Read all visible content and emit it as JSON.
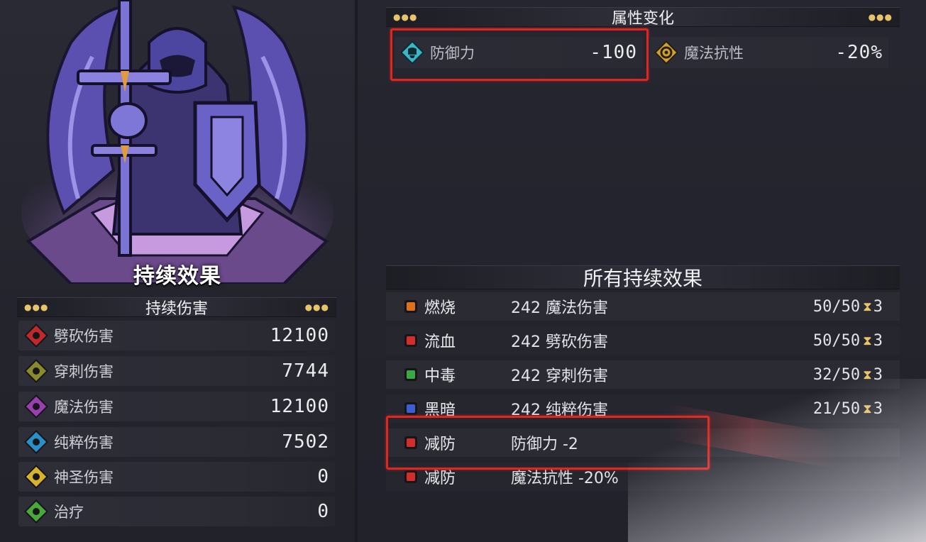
{
  "left": {
    "title": "持续效果",
    "section": "持续伤害",
    "stats": [
      {
        "icon": "slash-damage-icon",
        "label": "劈砍伤害",
        "value": "12100",
        "color": "#c0282a"
      },
      {
        "icon": "pierce-damage-icon",
        "label": "穿刺伤害",
        "value": "7744",
        "color": "#8a8a2a"
      },
      {
        "icon": "magic-damage-icon",
        "label": "魔法伤害",
        "value": "12100",
        "color": "#9a3fb0"
      },
      {
        "icon": "pure-damage-icon",
        "label": "纯粹伤害",
        "value": "7502",
        "color": "#2a8fc9"
      },
      {
        "icon": "holy-damage-icon",
        "label": "神圣伤害",
        "value": "0",
        "color": "#d8b22a"
      },
      {
        "icon": "heal-icon",
        "label": "治疗",
        "value": "0",
        "color": "#4aa83a"
      }
    ]
  },
  "right": {
    "attr_title": "属性变化",
    "attributes": [
      {
        "icon": "defense-icon",
        "label": "防御力",
        "value": "-100",
        "color": "#38b7c8"
      },
      {
        "icon": "magic-resist-icon",
        "label": "魔法抗性",
        "value": "-20%",
        "color": "#caa238"
      }
    ],
    "effects_title": "所有持续效果",
    "effects": [
      {
        "icon": "burn-icon",
        "name": "燃烧",
        "desc": "242 魔法伤害",
        "count": "50/50",
        "turns": "3",
        "color": "#e0701a"
      },
      {
        "icon": "bleed-icon",
        "name": "流血",
        "desc": "242 劈砍伤害",
        "count": "50/50",
        "turns": "3",
        "color": "#d0302a"
      },
      {
        "icon": "poison-icon",
        "name": "中毒",
        "desc": "242 穿刺伤害",
        "count": "32/50",
        "turns": "3",
        "color": "#3aa844"
      },
      {
        "icon": "dark-icon",
        "name": "黑暗",
        "desc": "242 纯粹伤害",
        "count": "21/50",
        "turns": "3",
        "color": "#3b5fd0"
      },
      {
        "icon": "armor-break-icon",
        "name": "减防",
        "desc": "防御力 -2",
        "count": "",
        "turns": "",
        "color": "#d0302a"
      },
      {
        "icon": "armor-break-icon",
        "name": "减防",
        "desc": "魔法抗性 -20%",
        "count": "",
        "turns": "",
        "color": "#d0302a"
      }
    ]
  },
  "colors": {
    "highlight": "#e0261f",
    "accent_gold": "#e7c36a"
  }
}
